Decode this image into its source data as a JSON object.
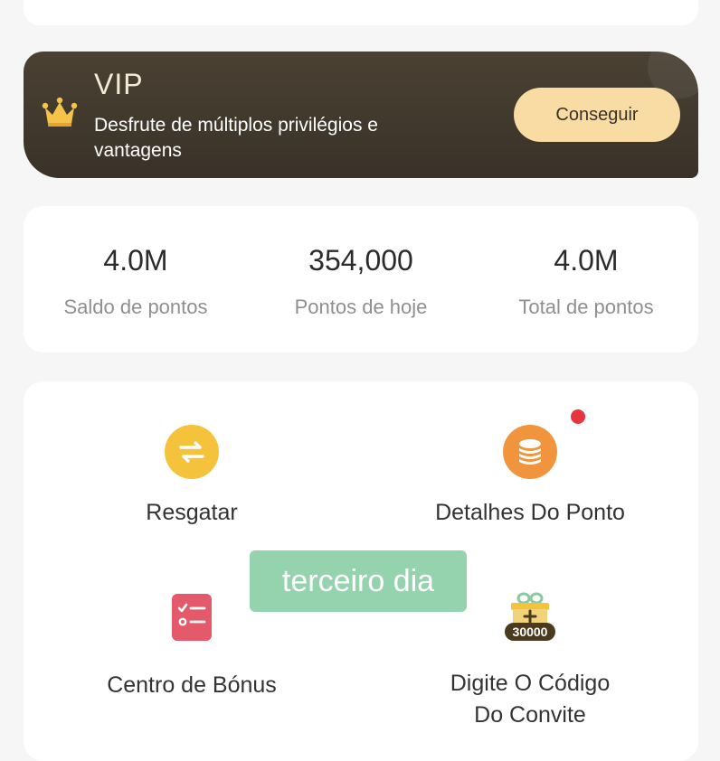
{
  "vip": {
    "title": "VIP",
    "description": "Desfrute de múltiplos privilégios e vantagens",
    "button_label": "Conseguir"
  },
  "stats": [
    {
      "value": "4.0M",
      "label": "Saldo de pontos"
    },
    {
      "value": "354,000",
      "label": "Pontos de hoje"
    },
    {
      "value": "4.0M",
      "label": "Total de pontos"
    }
  ],
  "menu": {
    "redeem": {
      "label": "Resgatar",
      "icon": "swap-arrows-icon"
    },
    "points_details": {
      "label": "Detalhes Do Ponto",
      "icon": "coin-stack-icon",
      "has_notification": true
    },
    "bonus_center": {
      "label": "Centro de Bónus",
      "icon": "checklist-icon"
    },
    "invite_code": {
      "label_line1": "Digite O Código",
      "label_line2": "Do Convite",
      "icon": "gift-30000-icon",
      "badge_text": "30000"
    }
  },
  "overlay": {
    "text": "terceiro dia"
  },
  "colors": {
    "vip_bg": "#3f372c",
    "vip_button": "#f8dca4",
    "redeem_icon": "#f5c33b",
    "points_icon": "#f0953e",
    "bonus_icon": "#e45a6a",
    "notification_dot": "#e5363f",
    "overlay": "#8acea6"
  }
}
